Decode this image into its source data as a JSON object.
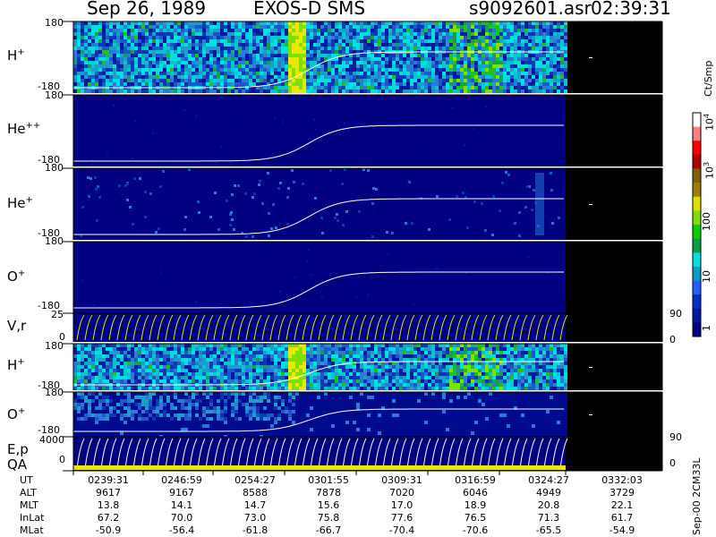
{
  "header": {
    "date": "Sep 26, 1989",
    "mission": "EXOS-D SMS",
    "file": "s9092601.asr",
    "time": "02:39:31"
  },
  "panels": [
    {
      "id": "h-plus",
      "species": "H",
      "charge": "+",
      "top": "180",
      "bottom": "-180"
    },
    {
      "id": "he-plusplus",
      "species": "He",
      "charge": "++",
      "top": "180",
      "bottom": "-180"
    },
    {
      "id": "he-plus",
      "species": "He",
      "charge": "+",
      "top": "180",
      "bottom": "-180"
    },
    {
      "id": "o-plus",
      "species": "O",
      "charge": "+",
      "top": "180",
      "bottom": "-180"
    },
    {
      "id": "vr",
      "label": "V,r",
      "top": "25",
      "bottom": "0",
      "right_top": "90",
      "right_bottom": "0"
    },
    {
      "id": "h-plus-2",
      "species": "H",
      "charge": "+",
      "top": "180",
      "bottom": "-180"
    },
    {
      "id": "o-plus-2",
      "species": "O",
      "charge": "+",
      "top": "180",
      "bottom": "-180"
    },
    {
      "id": "ep-qa",
      "label": "E,p",
      "label2": "QA",
      "top": "4000",
      "bottom": "0",
      "right_top": "90",
      "right_bottom": "0"
    }
  ],
  "colorbar": {
    "unit": "Ct/Smp",
    "ticks": [
      {
        "base": "10",
        "exp": "4"
      },
      {
        "base": "10",
        "exp": "3"
      },
      {
        "base": "100",
        "exp": ""
      },
      {
        "base": "10",
        "exp": ""
      },
      {
        "base": "1",
        "exp": ""
      }
    ],
    "colors": [
      "#000080",
      "#0018a0",
      "#0030c8",
      "#2060ff",
      "#00a0c8",
      "#00e0e0",
      "#00a040",
      "#00d000",
      "#80e000",
      "#e0e000",
      "#a08000",
      "#806000",
      "#b00000",
      "#ff0000",
      "#ff8080",
      "#ffffff"
    ]
  },
  "footer_id": "Sep-00 2CM33L",
  "orbit": {
    "rows": [
      {
        "label": "UT",
        "values": [
          "0239:31",
          "0246:59",
          "0254:27",
          "0301:55",
          "0309:31",
          "0316:59",
          "0324:27",
          "0332:03"
        ]
      },
      {
        "label": "ALT",
        "values": [
          "9617",
          "9167",
          "8588",
          "7878",
          "7020",
          "6046",
          "4949",
          "3729"
        ]
      },
      {
        "label": "MLT",
        "values": [
          "13.8",
          "14.1",
          "14.7",
          "15.6",
          "17.0",
          "18.9",
          "20.8",
          "22.1"
        ]
      },
      {
        "label": "InLat",
        "values": [
          "67.2",
          "70.0",
          "73.0",
          "75.8",
          "77.6",
          "76.5",
          "71.3",
          "61.7"
        ]
      },
      {
        "label": "MLat",
        "values": [
          "-50.9",
          "-56.4",
          "-61.8",
          "-66.7",
          "-70.4",
          "-70.6",
          "-65.5",
          "-54.9"
        ]
      }
    ]
  },
  "chart_data": {
    "type": "heatmap",
    "title": "Sep 26, 1989 EXOS-D SMS",
    "xlabel": "UT",
    "x": [
      "0239:31",
      "0246:59",
      "0254:27",
      "0301:55",
      "0309:31",
      "0316:59",
      "0324:27",
      "0332:03"
    ],
    "color_scale": "log",
    "color_range": [
      1,
      10000
    ],
    "panels": [
      {
        "name": "H+",
        "ylim": [
          -180,
          180
        ]
      },
      {
        "name": "He++",
        "ylim": [
          -180,
          180
        ]
      },
      {
        "name": "He+",
        "ylim": [
          -180,
          180
        ]
      },
      {
        "name": "O+",
        "ylim": [
          -180,
          180
        ]
      },
      {
        "name": "V,r",
        "ylim": [
          0,
          25
        ],
        "right_ylim": [
          0,
          90
        ]
      },
      {
        "name": "H+",
        "ylim": [
          -180,
          180
        ]
      },
      {
        "name": "O+",
        "ylim": [
          -180,
          180
        ]
      },
      {
        "name": "E,p",
        "ylim": [
          0,
          4000
        ],
        "right_ylim": [
          0,
          90
        ]
      }
    ]
  }
}
